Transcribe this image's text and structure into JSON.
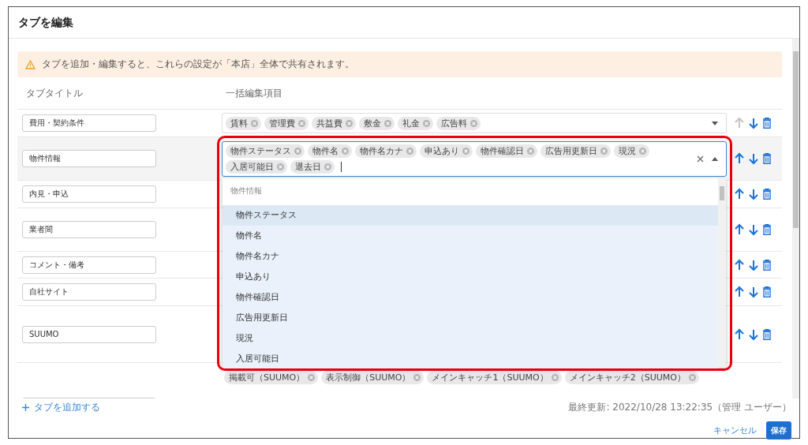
{
  "dialog": {
    "title": "タブを編集"
  },
  "notice": {
    "text": "タブを追加・編集すると、これらの設定が「本店」全体で共有されます。"
  },
  "columns": [
    "タブタイトル",
    "一括編集項目"
  ],
  "rows": [
    {
      "title": "費用・契約条件",
      "tags": [
        "賃料",
        "管理費",
        "共益費",
        "敷金",
        "礼金",
        "広告料"
      ],
      "expanded": false,
      "up_disabled": true
    },
    {
      "title": "物件情報",
      "tags": [
        "物件ステータス",
        "物件名",
        "物件名カナ",
        "申込あり",
        "物件確認日",
        "広告用更新日",
        "現況",
        "入居可能日",
        "退去日"
      ],
      "expanded": true,
      "up_disabled": false
    },
    {
      "title": "内見・申込",
      "up_disabled": false
    },
    {
      "title": "業者間",
      "up_disabled": false
    },
    {
      "title": "コメント・備考",
      "up_disabled": false
    },
    {
      "title": "自社サイト",
      "up_disabled": false
    },
    {
      "title": "SUUMO",
      "up_disabled": false
    },
    {
      "tags": [
        "掲載可（SUUMO）",
        "表示制御（SUUMO）",
        "メインキャッチ1（SUUMO）",
        "メインキャッチ2（SUUMO）"
      ]
    }
  ],
  "dropdown": {
    "group": "物件情報",
    "options": [
      {
        "label": "物件ステータス",
        "selected": true
      },
      {
        "label": "物件名",
        "selected": false
      },
      {
        "label": "物件名カナ",
        "selected": false
      },
      {
        "label": "申込あり",
        "selected": false
      },
      {
        "label": "物件確認日",
        "selected": false
      },
      {
        "label": "広告用更新日",
        "selected": false
      },
      {
        "label": "現況",
        "selected": false
      },
      {
        "label": "入居可能日",
        "selected": false
      }
    ]
  },
  "add_tab": {
    "label": "タブを追加する"
  },
  "last_updated": "最終更新: 2022/10/28 13:22:35（管理 ユーザー）",
  "buttons": [
    {
      "label": "キャンセル",
      "kind": "text"
    },
    {
      "label": "保存",
      "kind": "primary"
    }
  ]
}
